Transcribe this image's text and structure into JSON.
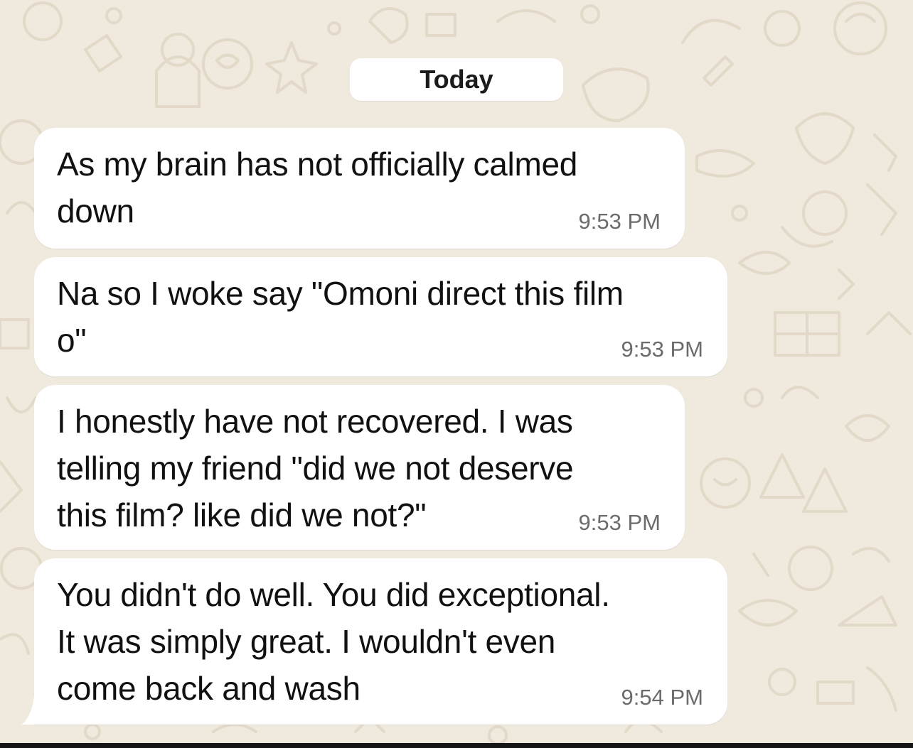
{
  "chat": {
    "date_divider": "Today",
    "messages": [
      {
        "text": "As my brain has not officially calmed\ndown",
        "time": "9:53 PM"
      },
      {
        "text": "Na so I woke say \"Omoni direct this film\no\"",
        "time": "9:53 PM"
      },
      {
        "text": "I honestly have not recovered. I was\ntelling my friend \"did we not deserve\nthis film? like did we not?\"",
        "time": "9:53 PM"
      },
      {
        "text": "You didn't do well. You did exceptional.\nIt was simply great. I wouldn't even\ncome back and wash",
        "time": "9:54 PM"
      }
    ]
  },
  "colors": {
    "background": "#efe9de",
    "bubble": "#ffffff",
    "timestamp": "#6b6b6b"
  }
}
